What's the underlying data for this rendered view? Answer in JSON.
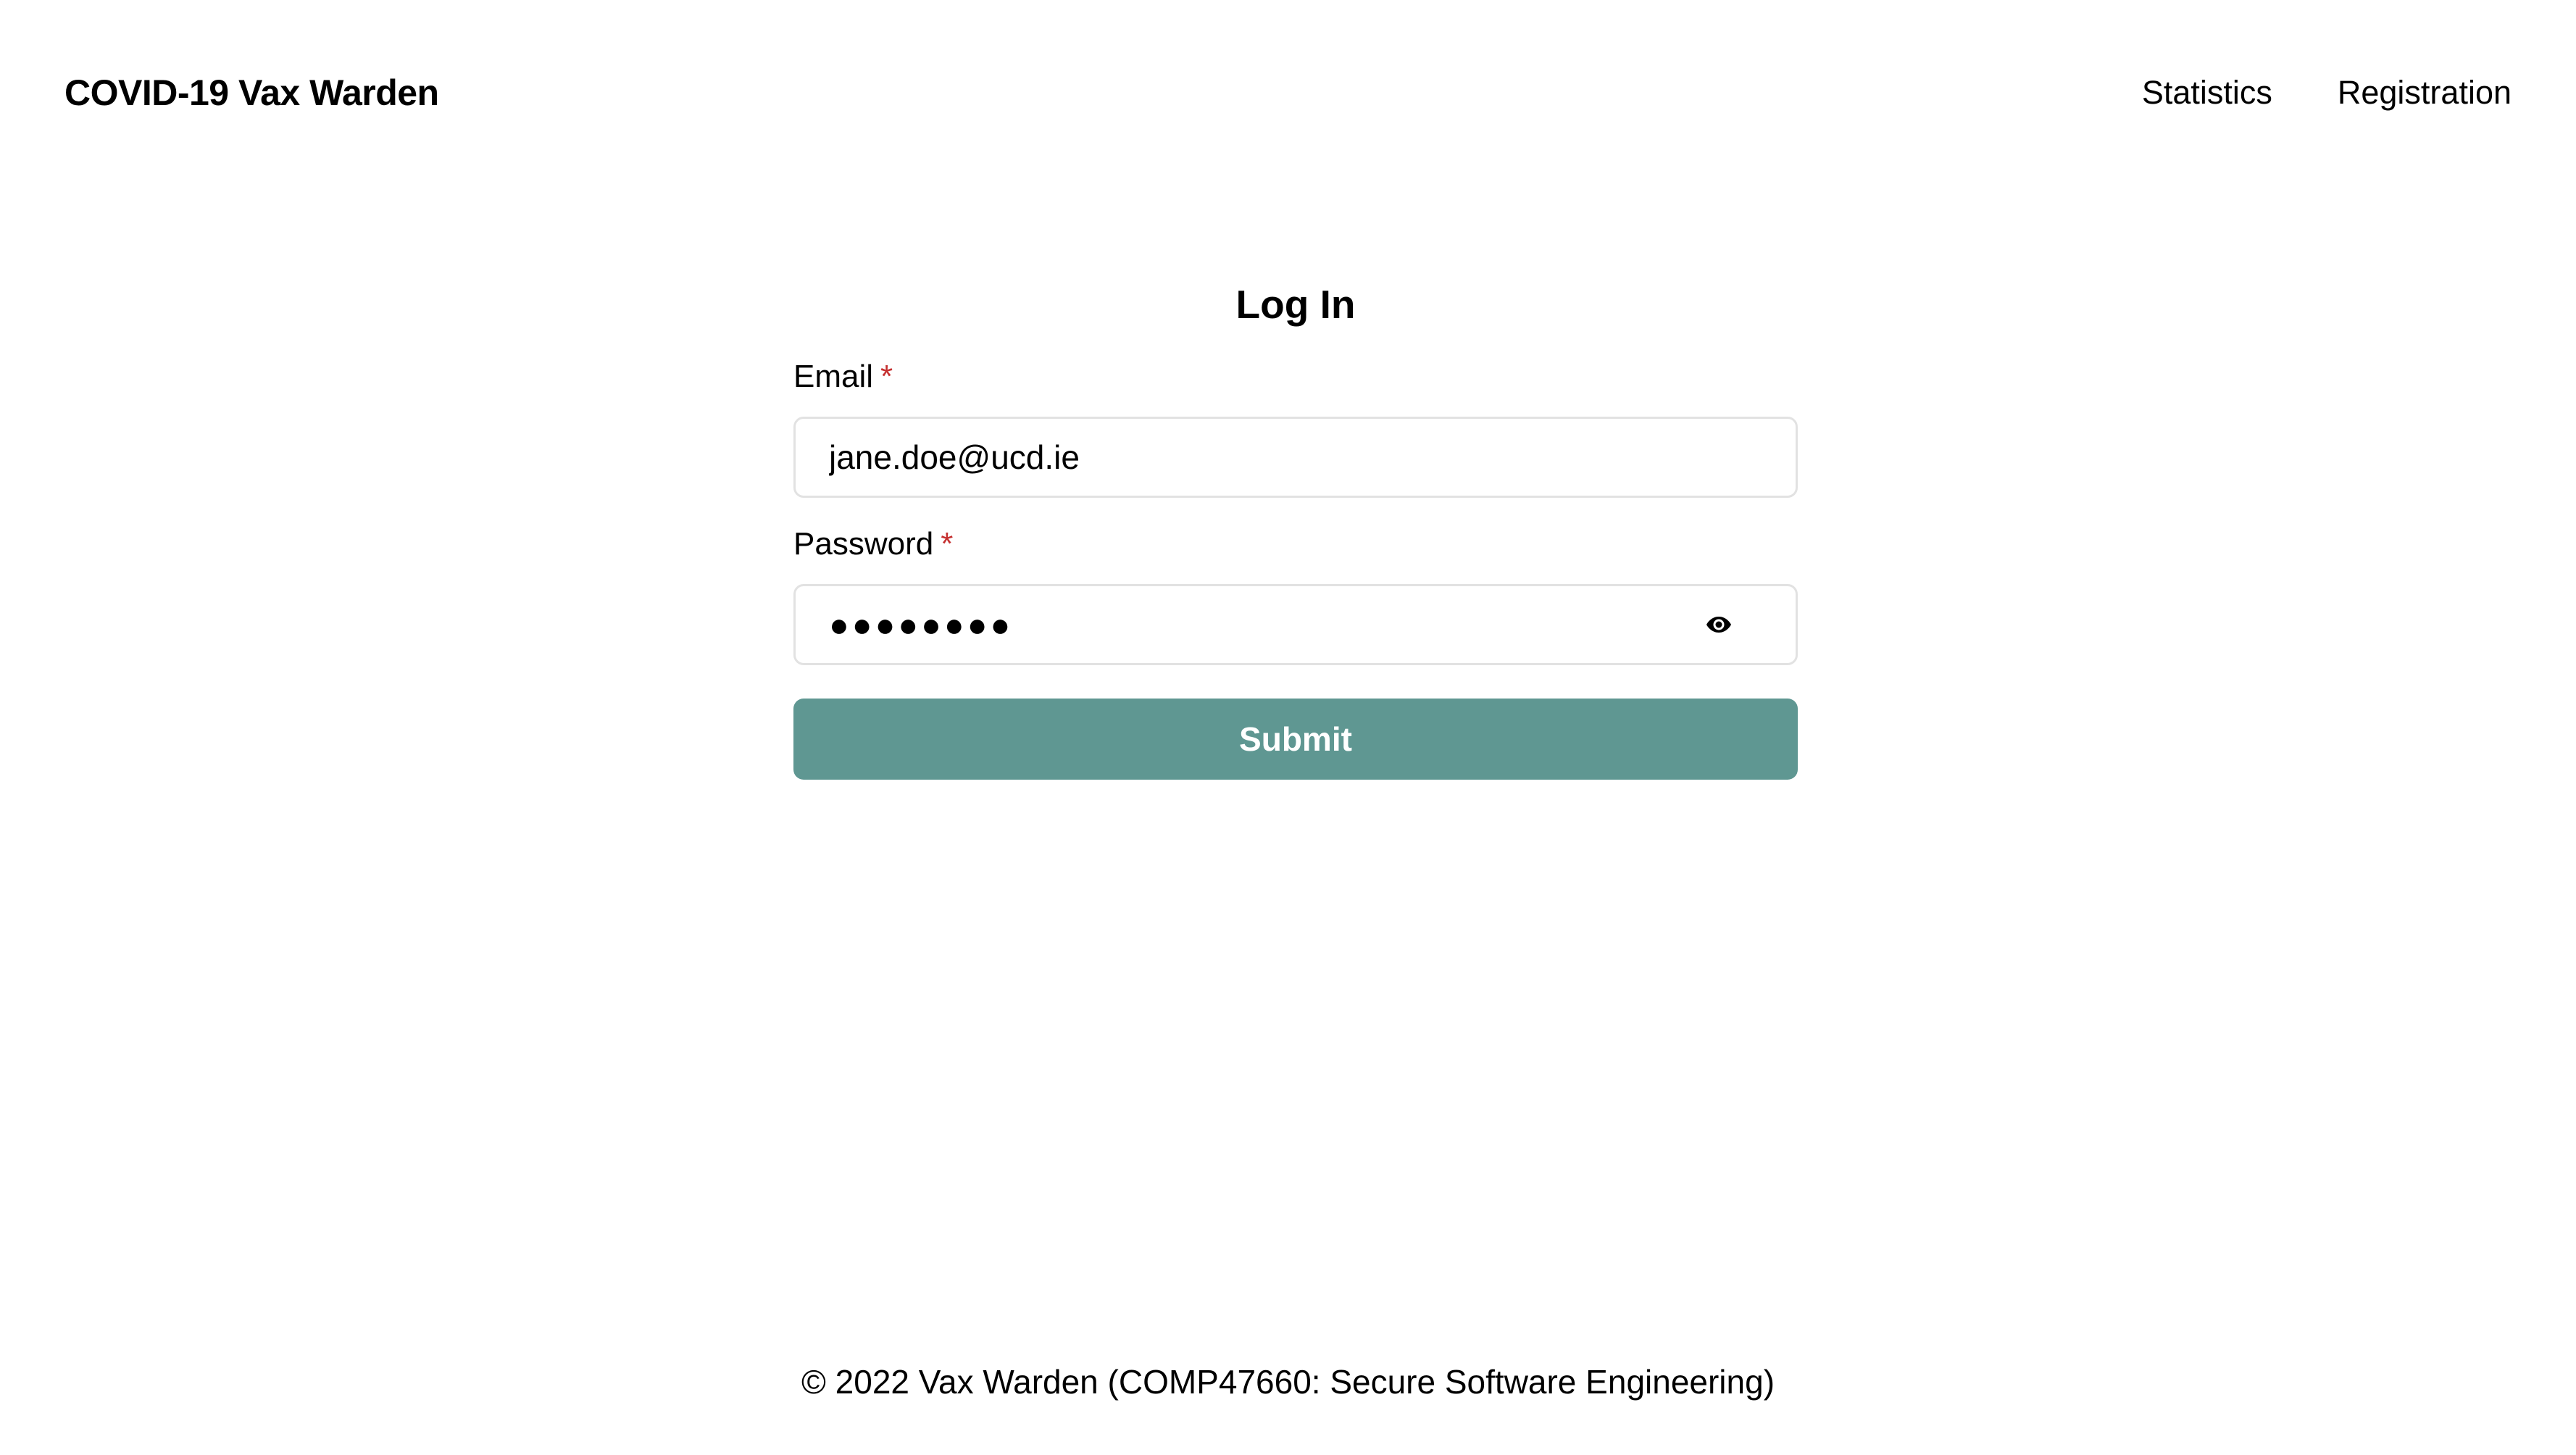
{
  "header": {
    "brand": "COVID-19 Vax Warden",
    "nav": [
      {
        "label": "Statistics"
      },
      {
        "label": "Registration"
      }
    ]
  },
  "login": {
    "title": "Log In",
    "email": {
      "label": "Email",
      "required_marker": "*",
      "value": "jane.doe@ucd.ie"
    },
    "password": {
      "label": "Password",
      "required_marker": "*",
      "masked_value": "●●●●●●●●",
      "toggle_icon": "eye-icon"
    },
    "submit_label": "Submit"
  },
  "footer": {
    "text": "© 2022 Vax Warden (COMP47660: Secure Software Engineering)"
  },
  "colors": {
    "accent": "#5f9792",
    "required": "#c53030",
    "input_border": "#e2e2e2"
  }
}
